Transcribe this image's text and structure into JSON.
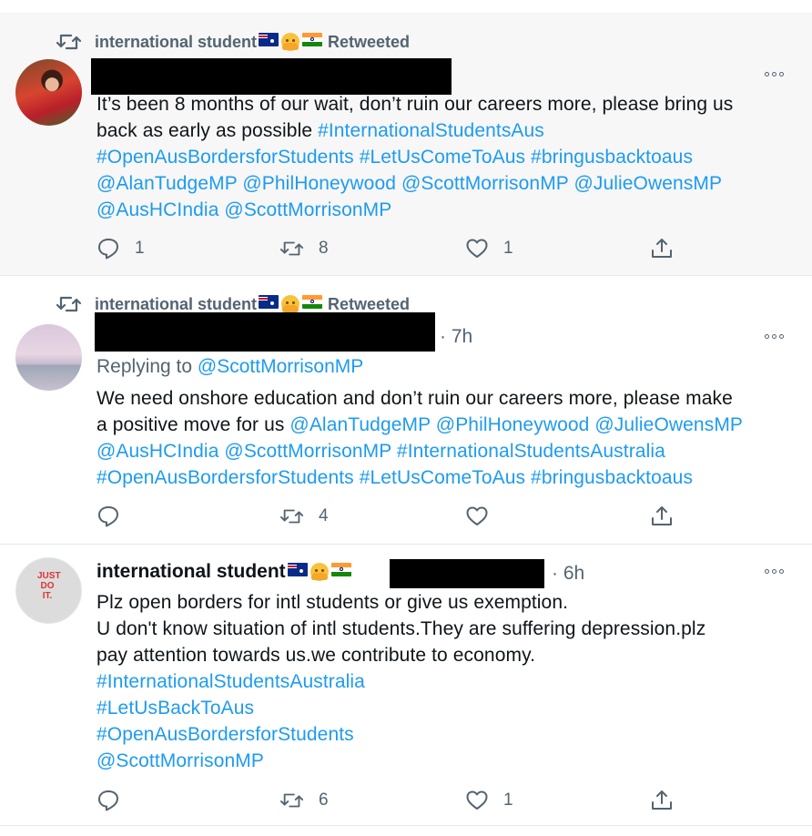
{
  "tweets": [
    {
      "retweeted_by": "international student",
      "retweeted_label": "Retweeted",
      "time": "",
      "replying_prefix": "",
      "replying_to": "",
      "text_lines": [
        [
          {
            "t": "It’s been 8 months of our wait, don’t ruin our careers more, please bring us",
            "link": false
          }
        ],
        [
          {
            "t": "back as early as possible ",
            "link": false
          },
          {
            "t": "#InternationalStudentsAus",
            "link": true
          }
        ],
        [
          {
            "t": "#OpenAusBordersforStudents #LetUsComeToAus #bringusbacktoaus",
            "link": true
          }
        ],
        [
          {
            "t": "@AlanTudgeMP @PhilHoneywood @ScottMorrisonMP @JulieOwensMP",
            "link": true
          }
        ],
        [
          {
            "t": "@AusHCIndia @ScottMorrisonMP",
            "link": true
          }
        ]
      ],
      "counts": {
        "replies": "1",
        "retweets": "8",
        "likes": "1"
      }
    },
    {
      "retweeted_by": "international student",
      "retweeted_label": "Retweeted",
      "time": "· 7h",
      "replying_prefix": "Replying to ",
      "replying_to": "@ScottMorrisonMP",
      "text_lines": [
        [
          {
            "t": "We need onshore education and don’t ruin our careers more, please make",
            "link": false
          }
        ],
        [
          {
            "t": "a positive move for us ",
            "link": false
          },
          {
            "t": "@AlanTudgeMP @PhilHoneywood @JulieOwensMP",
            "link": true
          }
        ],
        [
          {
            "t": "@AusHCIndia @ScottMorrisonMP #InternationalStudentsAustralia",
            "link": true
          }
        ],
        [
          {
            "t": "#OpenAusBordersforStudents #LetUsComeToAus #bringusbacktoaus",
            "link": true
          }
        ]
      ],
      "counts": {
        "replies": "",
        "retweets": "4",
        "likes": ""
      }
    },
    {
      "author": "international student",
      "time": "· 6h",
      "avatar_sign": "JUST DO IT.",
      "text_lines": [
        [
          {
            "t": "Plz open borders for intl students or give us exemption.",
            "link": false
          }
        ],
        [
          {
            "t": "U don't know situation of intl students.They are suffering depression.plz",
            "link": false
          }
        ],
        [
          {
            "t": "pay attention towards us.we contribute to economy.",
            "link": false
          }
        ],
        [
          {
            "t": "#InternationalStudentsAustralia",
            "link": true
          }
        ],
        [
          {
            "t": "#LetUsBackToAus",
            "link": true
          }
        ],
        [
          {
            "t": "#OpenAusBordersforStudents",
            "link": true
          }
        ],
        [
          {
            "t": "@ScottMorrisonMP",
            "link": true
          }
        ]
      ],
      "counts": {
        "replies": "",
        "retweets": "6",
        "likes": "1"
      }
    }
  ],
  "icons": {
    "retweet": "retweet-icon",
    "reply": "reply-icon",
    "like": "heart-icon",
    "share": "share-icon",
    "more": "more-icon"
  },
  "colors": {
    "link": "#1d9bf0",
    "muted": "#536471",
    "text": "#0f1419",
    "highlight_bg": "#f7f7f7"
  }
}
